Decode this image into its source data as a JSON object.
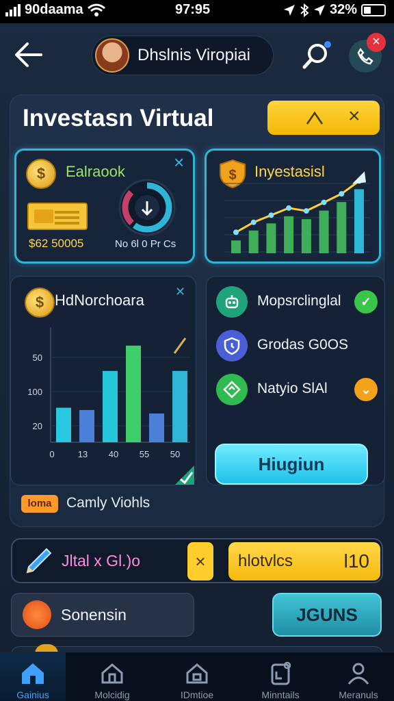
{
  "status_bar": {
    "carrier": "90daama",
    "time": "97:95",
    "battery": "32%"
  },
  "header": {
    "profile_name": "Dhslnis Viropiai"
  },
  "main": {
    "title": "Investasn Virtual",
    "balance_tile": {
      "label": "Ealraook",
      "amount": "$62 50005",
      "gauge_caption": "No 6l 0 Pr Cs"
    },
    "invest_tile": {
      "label": "Inyestasisl",
      "bars": [
        0.18,
        0.32,
        0.42,
        0.52,
        0.48,
        0.6,
        0.72,
        0.9
      ]
    },
    "chart_panel": {
      "title": "HdNorchoara",
      "y_ticks": [
        "50",
        "100",
        "20"
      ],
      "x_ticks": [
        "0",
        "13",
        "40",
        "55",
        "50"
      ]
    },
    "list": [
      {
        "label": "Mopsrclinglal",
        "badge": "✓",
        "badge_color": "#39c44a",
        "icon": "robot-icon",
        "icon_color": "#1fa37a"
      },
      {
        "label": "Grodas G0OS",
        "badge": "",
        "badge_color": "",
        "icon": "shield-clock-icon",
        "icon_color": "#4a5fd6"
      },
      {
        "label": "Natyio SlAl",
        "badge": "⌄",
        "badge_color": "#f4a21a",
        "icon": "diamond-icon",
        "icon_color": "#2fbb4f"
      }
    ],
    "cta_label": "Hiugiun",
    "footer_chip": "loma",
    "footer_text": "Camly Viohls"
  },
  "action_bar": {
    "label": "Jltal x Gl.)o",
    "x_label": "×",
    "yellow_label": "hlotvlcs",
    "yellow_value": "l10"
  },
  "row": {
    "label": "Sonensin",
    "join_label": "JGUNS"
  },
  "nav": {
    "items": [
      {
        "label": "Gainius",
        "icon": "home-icon"
      },
      {
        "label": "Molcidig",
        "icon": "home-outline-icon"
      },
      {
        "label": "IDmtioe",
        "icon": "building-icon"
      },
      {
        "label": "Minntails",
        "icon": "clipboard-icon"
      },
      {
        "label": "Meranuls",
        "icon": "person-icon"
      }
    ]
  },
  "chart_data": {
    "type": "bar",
    "title": "HdNorchoara",
    "xlabel": "",
    "ylabel": "",
    "x_ticks": [
      "0",
      "13",
      "40",
      "55",
      "50"
    ],
    "y_ticks": [
      "50",
      "100",
      "20"
    ],
    "values": [
      0.3,
      0.28,
      0.62,
      0.84,
      0.25,
      0.62
    ]
  },
  "colors": {
    "accent_cyan": "#2fb6d6",
    "accent_yellow": "#ffd43b",
    "accent_green": "#39c44a"
  }
}
